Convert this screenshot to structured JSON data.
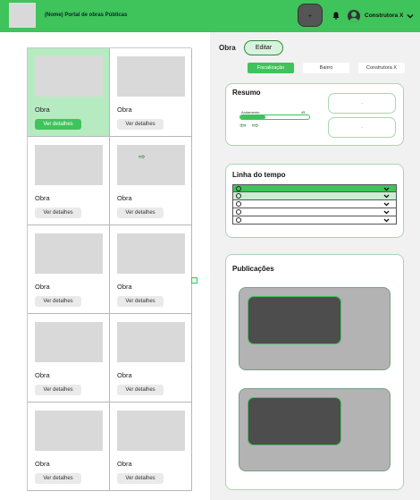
{
  "header": {
    "app_title": "(Nome) Portal de obras Públicas",
    "add_label": "+",
    "user_name": "Construtora X",
    "user_chevron": "❯"
  },
  "grid": {
    "cards": [
      {
        "title": "Obra",
        "button": "Ver detalhes",
        "selected": true
      },
      {
        "title": "Obra",
        "button": "Ver detalhes"
      },
      {
        "title": "Obra",
        "button": "Ver detalhes"
      },
      {
        "title": "Obra",
        "button": "Ver detalhes",
        "icon": "⇨"
      },
      {
        "title": "Obra",
        "button": "Ver detalhes"
      },
      {
        "title": "Obra",
        "button": "Ver detalhes"
      },
      {
        "title": "Obra",
        "button": "Ver detalhes"
      },
      {
        "title": "Obra",
        "button": "Ver detalhes"
      },
      {
        "title": "Obra",
        "button": "Ver detalhes"
      },
      {
        "title": "Obra",
        "button": "Ver detalhes"
      }
    ]
  },
  "detail": {
    "title": "Obra",
    "edit_label": "Editar",
    "tabs": [
      {
        "label": "Fiscalização",
        "active": true
      },
      {
        "label": "Bairro"
      },
      {
        "label": "Construtora X"
      }
    ]
  },
  "resumo": {
    "title": "Resumo",
    "progress_label": "Andamento",
    "progress_value": "45",
    "progress_fraction": 0.37,
    "arrow_left": "⇦",
    "arrow_right": "⇨",
    "stat_top": "-",
    "stat_bottom": "-"
  },
  "timeline": {
    "title": "Linha do tempo",
    "rows": [
      "",
      "",
      "",
      "",
      ""
    ]
  },
  "publicacoes": {
    "title": "Publicações"
  },
  "colors": {
    "brand": "#3fc35b",
    "selected_card": "#b6ebc2"
  }
}
